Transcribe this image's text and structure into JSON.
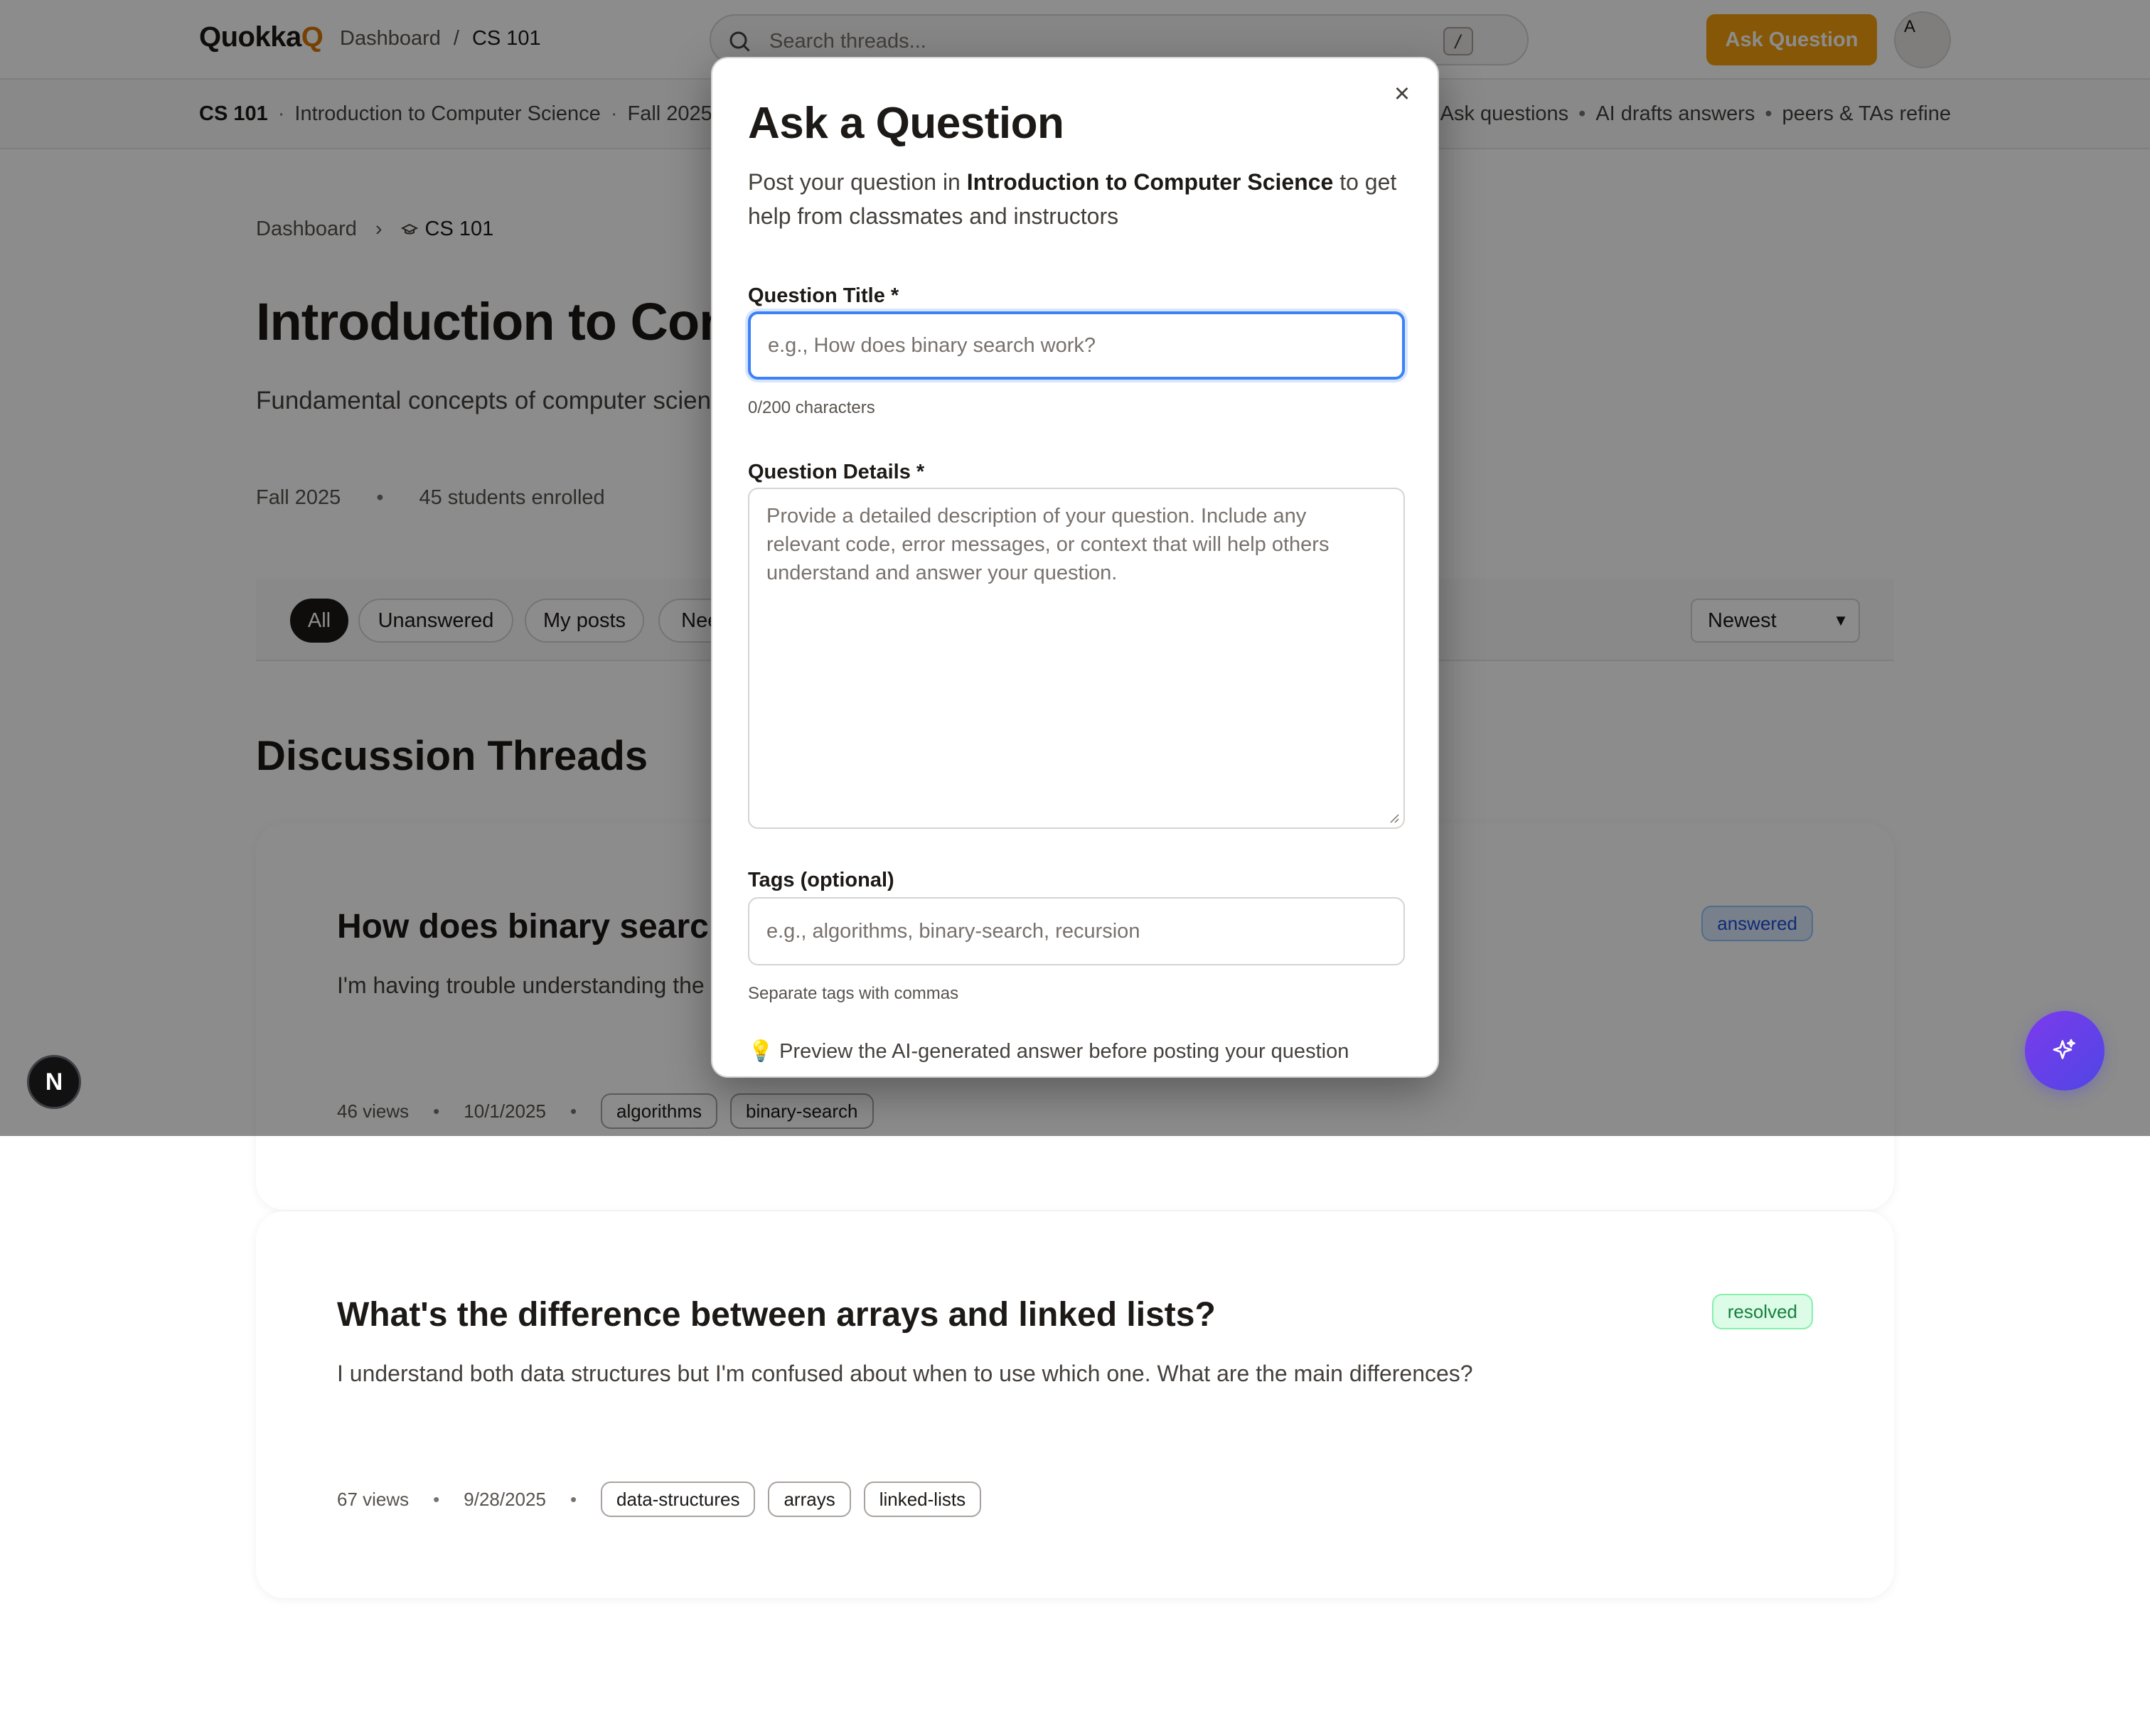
{
  "header": {
    "logo_text": "Quokka",
    "logo_accent": "Q",
    "breadcrumb": [
      "Dashboard",
      "/",
      "CS 101"
    ],
    "search_placeholder": "Search threads...",
    "search_shortcut": "/",
    "ask_button": "Ask Question",
    "avatar_initial": "A"
  },
  "course_bar": {
    "code": "CS 101",
    "name": "Introduction to Computer Science",
    "term": "Fall 2025",
    "tagline": [
      "Ask questions",
      "AI drafts answers",
      "peers & TAs refine"
    ],
    "separator": "·",
    "tagline_separator": "•"
  },
  "page": {
    "breadcrumb": [
      "Dashboard",
      "CS 101"
    ],
    "breadcrumb_separator": "›",
    "title": "Introduction to Computer Science",
    "description": "Fundamental concepts of computer science and programming.",
    "term": "Fall 2025",
    "meta_separator": "•",
    "enrolled": "45 students enrolled"
  },
  "filters": {
    "chips": [
      "All",
      "Unanswered",
      "My posts",
      "Needs review"
    ],
    "active": "All",
    "sort": "Newest"
  },
  "threads": {
    "section_title": "Discussion Threads",
    "items": [
      {
        "title": "How does binary search work?",
        "body": "I'm having trouble understanding the binary search algorithm. Can someone explain it step by step?",
        "status": "answered",
        "views": "46 views",
        "date": "10/1/2025",
        "tags": [
          "algorithms",
          "binary-search"
        ]
      },
      {
        "title": "What's the difference between arrays and linked lists?",
        "body": "I understand both data structures but I'm confused about when to use which one. What are the main differences?",
        "status": "resolved",
        "views": "67 views",
        "date": "9/28/2025",
        "tags": [
          "data-structures",
          "arrays",
          "linked-lists"
        ]
      }
    ]
  },
  "modal": {
    "title": "Ask a Question",
    "intro_prefix": "Post your question in ",
    "intro_course": "Introduction to Computer Science",
    "intro_suffix": " to get help from classmates and instructors",
    "title_label": "Question Title *",
    "title_placeholder": "e.g., How does binary search work?",
    "title_counter": "0/200 characters",
    "details_label": "Question Details *",
    "details_placeholder": "Provide a detailed description of your question. Include any relevant code, error messages, or context that will help others understand and answer your question.",
    "tags_label": "Tags (optional)",
    "tags_placeholder": "e.g., algorithms, binary-search, recursion",
    "tags_hint": "Separate tags with commas",
    "preview_icon": "💡",
    "preview_note": "Preview the AI-generated answer before posting your question",
    "close_icon": "×"
  },
  "floating": {
    "dev_badge": "N",
    "ai_button_icon": "sparkle-icon"
  },
  "colors": {
    "brand_accent": "#f59e0b",
    "logo_q": "#d97706",
    "focus_ring": "#3b82f6",
    "answered": "#1d4ed8",
    "resolved": "#15803d",
    "ai_gradient_start": "#7c3aed",
    "ai_gradient_end": "#4f46e5"
  }
}
